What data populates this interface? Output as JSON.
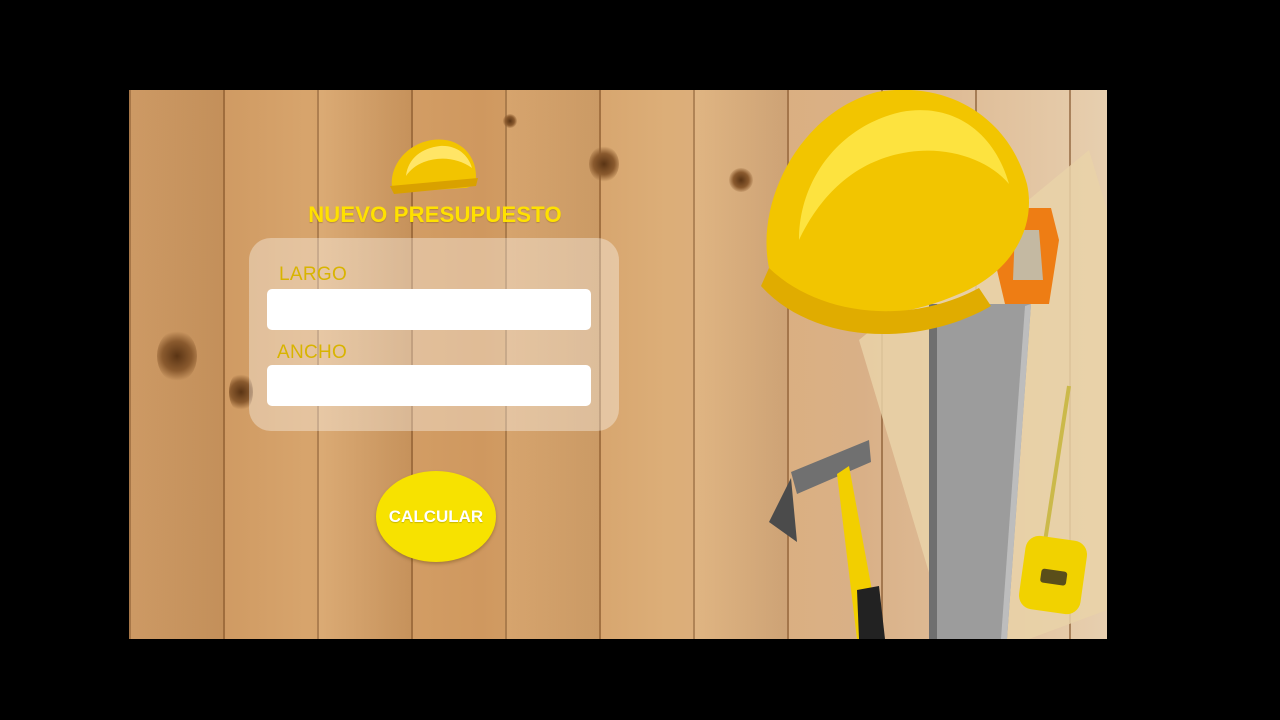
{
  "app": {
    "title": "NUEVO PRESUPUESTO",
    "fields": [
      {
        "label": "LARGO",
        "value": "",
        "placeholder": ""
      },
      {
        "label": "ANCHO",
        "value": "",
        "placeholder": ""
      }
    ],
    "calculate_label": "CALCULAR"
  },
  "colors": {
    "accent": "#ffe100",
    "label": "#d8b400",
    "button": "#f7e200",
    "frame": "#000000"
  },
  "icons": {
    "header": "hard-hat-icon"
  }
}
